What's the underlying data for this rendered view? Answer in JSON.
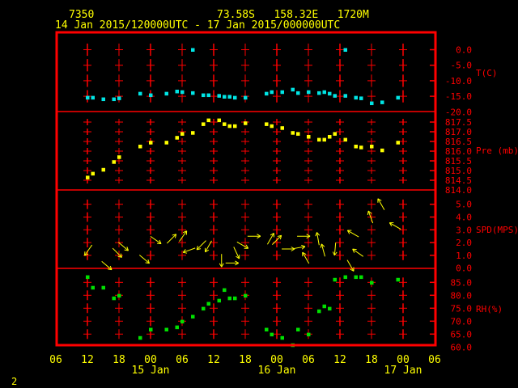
{
  "header": {
    "station": "7350",
    "location": "73.58S   158.32E   1720M",
    "period": "14 Jan 2015/120000UTC - 17 Jan 2015/000000UTC"
  },
  "page_number": "2",
  "colors": {
    "background": "#000000",
    "frame": "#ff0000",
    "text": "#ffff00",
    "temperature": "#00e5e5",
    "pressure": "#ffff00",
    "wind": "#ffff00",
    "humidity": "#00e000"
  },
  "chart_data": {
    "type": "scatter",
    "x_axis": {
      "range": [
        "14 06:00",
        "17 06:00"
      ],
      "tick_labels": [
        "06",
        "12",
        "18",
        "00",
        "06",
        "12",
        "18",
        "00",
        "06",
        "12",
        "18",
        "00",
        "06"
      ],
      "date_labels": [
        "15 Jan",
        "16 Jan",
        "17 Jan"
      ]
    },
    "panels": [
      {
        "label": "T(C)",
        "ylim": [
          -20,
          0
        ],
        "tick_labels": [
          "0.0",
          "-5.0",
          "-10.0",
          "-15.0",
          "-20.0"
        ],
        "points": [
          [
            "14 12:00",
            -15.4
          ],
          [
            "14 13:00",
            -15.4
          ],
          [
            "14 15:00",
            -15.9
          ],
          [
            "14 17:00",
            -15.9
          ],
          [
            "14 18:00",
            -15.6
          ],
          [
            "14 22:00",
            -14.1
          ],
          [
            "15 00:00",
            -14.6
          ],
          [
            "15 03:00",
            -14.1
          ],
          [
            "15 05:00",
            -13.4
          ],
          [
            "15 06:00",
            -13.6
          ],
          [
            "15 08:00",
            0.0
          ],
          [
            "15 08:00",
            -13.9
          ],
          [
            "15 10:00",
            -14.6
          ],
          [
            "15 11:00",
            -14.6
          ],
          [
            "15 13:00",
            -14.8
          ],
          [
            "15 14:00",
            -15.1
          ],
          [
            "15 15:00",
            -15.1
          ],
          [
            "15 16:00",
            -15.4
          ],
          [
            "15 18:00",
            -15.4
          ],
          [
            "15 22:00",
            -14.1
          ],
          [
            "15 23:00",
            -13.6
          ],
          [
            "16 01:00",
            -13.6
          ],
          [
            "16 03:00",
            -12.8
          ],
          [
            "16 04:00",
            -13.9
          ],
          [
            "16 06:00",
            -13.6
          ],
          [
            "16 08:00",
            -13.9
          ],
          [
            "16 09:00",
            -13.6
          ],
          [
            "16 10:00",
            -14.1
          ],
          [
            "16 11:00",
            -14.8
          ],
          [
            "16 13:00",
            0.0
          ],
          [
            "16 13:00",
            -14.8
          ],
          [
            "16 15:00",
            -15.4
          ],
          [
            "16 16:00",
            -15.6
          ],
          [
            "16 18:00",
            -17.2
          ],
          [
            "16 20:00",
            -16.9
          ],
          [
            "16 23:00",
            -15.4
          ]
        ]
      },
      {
        "label": "Pre (mb)",
        "ylim": [
          814.0,
          817.5
        ],
        "tick_labels": [
          "817.5",
          "817.0",
          "816.5",
          "816.0",
          "815.5",
          "815.0",
          "814.5",
          "814.0"
        ],
        "points": [
          [
            "14 12:00",
            814.65
          ],
          [
            "14 13:00",
            814.85
          ],
          [
            "14 15:00",
            815.05
          ],
          [
            "14 17:00",
            815.45
          ],
          [
            "14 18:00",
            815.7
          ],
          [
            "14 22:00",
            816.25
          ],
          [
            "15 00:00",
            816.45
          ],
          [
            "15 03:00",
            816.45
          ],
          [
            "15 05:00",
            816.7
          ],
          [
            "15 06:00",
            816.9
          ],
          [
            "15 08:00",
            816.95
          ],
          [
            "15 10:00",
            817.4
          ],
          [
            "15 11:00",
            817.6
          ],
          [
            "15 13:00",
            817.6
          ],
          [
            "15 14:00",
            817.4
          ],
          [
            "15 15:00",
            817.3
          ],
          [
            "15 16:00",
            817.3
          ],
          [
            "15 18:00",
            817.45
          ],
          [
            "15 22:00",
            817.4
          ],
          [
            "15 23:00",
            817.3
          ],
          [
            "16 01:00",
            817.2
          ],
          [
            "16 03:00",
            816.95
          ],
          [
            "16 04:00",
            816.9
          ],
          [
            "16 06:00",
            816.75
          ],
          [
            "16 08:00",
            816.6
          ],
          [
            "16 09:00",
            816.6
          ],
          [
            "16 10:00",
            816.75
          ],
          [
            "16 11:00",
            816.9
          ],
          [
            "16 13:00",
            816.6
          ],
          [
            "16 15:00",
            816.25
          ],
          [
            "16 16:00",
            816.2
          ],
          [
            "16 18:00",
            816.25
          ],
          [
            "16 20:00",
            816.05
          ],
          [
            "16 23:00",
            816.45
          ]
        ]
      },
      {
        "label": "SPD(MPS)",
        "ylim": [
          0,
          5
        ],
        "tick_labels": [
          "5.0",
          "4.0",
          "3.0",
          "2.0",
          "1.0",
          "0.0"
        ],
        "arrows": [
          [
            "14 12:10",
            1.4,
            215
          ],
          [
            "14 15:40",
            0.2,
            130
          ],
          [
            "14 17:40",
            1.2,
            135
          ],
          [
            "14 18:50",
            1.7,
            130
          ],
          [
            "14 22:50",
            0.7,
            130
          ],
          [
            "15 01:00",
            2.2,
            125
          ],
          [
            "15 04:00",
            2.3,
            45
          ],
          [
            "15 06:10",
            2.5,
            35
          ],
          [
            "15 07:20",
            1.4,
            250
          ],
          [
            "15 09:40",
            1.8,
            225
          ],
          [
            "15 11:00",
            1.7,
            210
          ],
          [
            "15 13:30",
            0.6,
            180
          ],
          [
            "15 15:30",
            0.4,
            90
          ],
          [
            "15 16:20",
            1.2,
            155
          ],
          [
            "15 17:30",
            1.8,
            120
          ],
          [
            "15 19:40",
            2.5,
            90
          ],
          [
            "15 22:50",
            2.3,
            30
          ],
          [
            "16 00:00",
            2.2,
            45
          ],
          [
            "16 02:10",
            1.5,
            90
          ],
          [
            "16 04:10",
            1.6,
            80
          ],
          [
            "16 05:05",
            2.5,
            90
          ],
          [
            "16 05:30",
            0.8,
            330
          ],
          [
            "16 07:50",
            2.3,
            350
          ],
          [
            "16 08:50",
            1.4,
            345
          ],
          [
            "16 11:05",
            1.5,
            185
          ],
          [
            "16 14:00",
            0.2,
            150
          ],
          [
            "16 14:30",
            2.7,
            300
          ],
          [
            "16 15:25",
            1.2,
            305
          ],
          [
            "16 17:50",
            4.0,
            340
          ],
          [
            "16 19:50",
            5.0,
            330
          ],
          [
            "16 22:30",
            3.3,
            300
          ]
        ]
      },
      {
        "label": "RH(%)",
        "ylim": [
          60,
          85
        ],
        "tick_labels": [
          "85.0",
          "80.0",
          "75.0",
          "70.0",
          "65.0",
          "60.0"
        ],
        "points": [
          [
            "14 12:00",
            87.1
          ],
          [
            "14 13:00",
            83.0
          ],
          [
            "14 15:00",
            83.0
          ],
          [
            "14 17:00",
            78.9
          ],
          [
            "14 18:00",
            79.9
          ],
          [
            "14 22:00",
            63.6
          ],
          [
            "15 00:00",
            66.8
          ],
          [
            "15 03:00",
            66.8
          ],
          [
            "15 05:00",
            67.7
          ],
          [
            "15 06:00",
            69.9
          ],
          [
            "15 08:00",
            71.8
          ],
          [
            "15 10:00",
            74.9
          ],
          [
            "15 11:00",
            76.8
          ],
          [
            "15 13:00",
            78.0
          ],
          [
            "15 14:00",
            82.1
          ],
          [
            "15 15:00",
            78.9
          ],
          [
            "15 16:00",
            78.9
          ],
          [
            "15 18:00",
            79.9
          ],
          [
            "15 22:00",
            66.8
          ],
          [
            "15 23:00",
            64.9
          ],
          [
            "16 01:00",
            63.6
          ],
          [
            "16 03:00",
            60.8
          ],
          [
            "16 04:00",
            66.8
          ],
          [
            "16 06:00",
            64.9
          ],
          [
            "16 08:00",
            73.9
          ],
          [
            "16 09:00",
            75.8
          ],
          [
            "16 10:00",
            74.9
          ],
          [
            "16 11:00",
            86.1
          ],
          [
            "16 13:00",
            87.1
          ],
          [
            "16 15:00",
            87.1
          ],
          [
            "16 16:00",
            87.1
          ],
          [
            "16 18:00",
            84.9
          ],
          [
            "16 23:00",
            86.1
          ]
        ]
      }
    ]
  }
}
